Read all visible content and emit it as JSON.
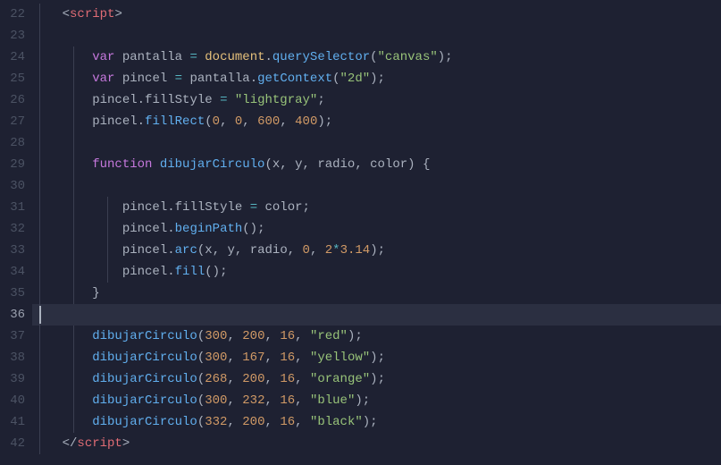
{
  "lineStart": 22,
  "activeLine": 36,
  "cursorLeft": 8,
  "indent": "    ",
  "lines": [
    {
      "pad": 1,
      "guides": [
        1
      ],
      "tokens": [
        {
          "c": "punc",
          "t": "<"
        },
        {
          "c": "tag",
          "t": "script"
        },
        {
          "c": "punc",
          "t": ">"
        }
      ]
    },
    {
      "pad": 1,
      "guides": [
        1
      ],
      "tokens": []
    },
    {
      "pad": 2,
      "guides": [
        1,
        2
      ],
      "tokens": [
        {
          "c": "kw",
          "t": "var"
        },
        {
          "c": "plain",
          "t": " "
        },
        {
          "c": "plain",
          "t": "pantalla"
        },
        {
          "c": "plain",
          "t": " "
        },
        {
          "c": "op",
          "t": "="
        },
        {
          "c": "plain",
          "t": " "
        },
        {
          "c": "var",
          "t": "document"
        },
        {
          "c": "punc",
          "t": "."
        },
        {
          "c": "fn",
          "t": "querySelector"
        },
        {
          "c": "punc",
          "t": "("
        },
        {
          "c": "str",
          "t": "\"canvas\""
        },
        {
          "c": "punc",
          "t": ")"
        },
        {
          "c": "punc",
          "t": ";"
        }
      ]
    },
    {
      "pad": 2,
      "guides": [
        1,
        2
      ],
      "tokens": [
        {
          "c": "kw",
          "t": "var"
        },
        {
          "c": "plain",
          "t": " "
        },
        {
          "c": "plain",
          "t": "pincel"
        },
        {
          "c": "plain",
          "t": " "
        },
        {
          "c": "op",
          "t": "="
        },
        {
          "c": "plain",
          "t": " "
        },
        {
          "c": "plain",
          "t": "pantalla"
        },
        {
          "c": "punc",
          "t": "."
        },
        {
          "c": "fn",
          "t": "getContext"
        },
        {
          "c": "punc",
          "t": "("
        },
        {
          "c": "str",
          "t": "\"2d\""
        },
        {
          "c": "punc",
          "t": ")"
        },
        {
          "c": "punc",
          "t": ";"
        }
      ]
    },
    {
      "pad": 2,
      "guides": [
        1,
        2
      ],
      "tokens": [
        {
          "c": "plain",
          "t": "pincel"
        },
        {
          "c": "punc",
          "t": "."
        },
        {
          "c": "plain",
          "t": "fillStyle"
        },
        {
          "c": "plain",
          "t": " "
        },
        {
          "c": "op",
          "t": "="
        },
        {
          "c": "plain",
          "t": " "
        },
        {
          "c": "str",
          "t": "\"lightgray\""
        },
        {
          "c": "punc",
          "t": ";"
        }
      ]
    },
    {
      "pad": 2,
      "guides": [
        1,
        2
      ],
      "tokens": [
        {
          "c": "plain",
          "t": "pincel"
        },
        {
          "c": "punc",
          "t": "."
        },
        {
          "c": "fn",
          "t": "fillRect"
        },
        {
          "c": "punc",
          "t": "("
        },
        {
          "c": "num",
          "t": "0"
        },
        {
          "c": "punc",
          "t": ", "
        },
        {
          "c": "num",
          "t": "0"
        },
        {
          "c": "punc",
          "t": ", "
        },
        {
          "c": "num",
          "t": "600"
        },
        {
          "c": "punc",
          "t": ", "
        },
        {
          "c": "num",
          "t": "400"
        },
        {
          "c": "punc",
          "t": ")"
        },
        {
          "c": "punc",
          "t": ";"
        }
      ]
    },
    {
      "pad": 2,
      "guides": [
        1,
        2
      ],
      "tokens": []
    },
    {
      "pad": 2,
      "guides": [
        1,
        2
      ],
      "tokens": [
        {
          "c": "kw",
          "t": "function"
        },
        {
          "c": "plain",
          "t": " "
        },
        {
          "c": "fn",
          "t": "dibujarCirculo"
        },
        {
          "c": "punc",
          "t": "("
        },
        {
          "c": "param",
          "t": "x"
        },
        {
          "c": "punc",
          "t": ", "
        },
        {
          "c": "param",
          "t": "y"
        },
        {
          "c": "punc",
          "t": ", "
        },
        {
          "c": "param",
          "t": "radio"
        },
        {
          "c": "punc",
          "t": ", "
        },
        {
          "c": "param",
          "t": "color"
        },
        {
          "c": "punc",
          "t": ")"
        },
        {
          "c": "plain",
          "t": " "
        },
        {
          "c": "punc",
          "t": "{"
        }
      ]
    },
    {
      "pad": 2,
      "guides": [
        1,
        2
      ],
      "tokens": []
    },
    {
      "pad": 3,
      "guides": [
        1,
        2,
        3
      ],
      "tokens": [
        {
          "c": "plain",
          "t": "pincel"
        },
        {
          "c": "punc",
          "t": "."
        },
        {
          "c": "plain",
          "t": "fillStyle"
        },
        {
          "c": "plain",
          "t": " "
        },
        {
          "c": "op",
          "t": "="
        },
        {
          "c": "plain",
          "t": " "
        },
        {
          "c": "plain",
          "t": "color"
        },
        {
          "c": "punc",
          "t": ";"
        }
      ]
    },
    {
      "pad": 3,
      "guides": [
        1,
        2,
        3
      ],
      "tokens": [
        {
          "c": "plain",
          "t": "pincel"
        },
        {
          "c": "punc",
          "t": "."
        },
        {
          "c": "fn",
          "t": "beginPath"
        },
        {
          "c": "punc",
          "t": "()"
        },
        {
          "c": "punc",
          "t": ";"
        }
      ]
    },
    {
      "pad": 3,
      "guides": [
        1,
        2,
        3
      ],
      "tokens": [
        {
          "c": "plain",
          "t": "pincel"
        },
        {
          "c": "punc",
          "t": "."
        },
        {
          "c": "fn",
          "t": "arc"
        },
        {
          "c": "punc",
          "t": "("
        },
        {
          "c": "plain",
          "t": "x"
        },
        {
          "c": "punc",
          "t": ", "
        },
        {
          "c": "plain",
          "t": "y"
        },
        {
          "c": "punc",
          "t": ", "
        },
        {
          "c": "plain",
          "t": "radio"
        },
        {
          "c": "punc",
          "t": ", "
        },
        {
          "c": "num",
          "t": "0"
        },
        {
          "c": "punc",
          "t": ", "
        },
        {
          "c": "num",
          "t": "2"
        },
        {
          "c": "op",
          "t": "*"
        },
        {
          "c": "num",
          "t": "3.14"
        },
        {
          "c": "punc",
          "t": ")"
        },
        {
          "c": "punc",
          "t": ";"
        }
      ]
    },
    {
      "pad": 3,
      "guides": [
        1,
        2,
        3
      ],
      "tokens": [
        {
          "c": "plain",
          "t": "pincel"
        },
        {
          "c": "punc",
          "t": "."
        },
        {
          "c": "fn",
          "t": "fill"
        },
        {
          "c": "punc",
          "t": "()"
        },
        {
          "c": "punc",
          "t": ";"
        }
      ]
    },
    {
      "pad": 2,
      "guides": [
        1,
        2
      ],
      "tokens": [
        {
          "c": "punc",
          "t": "}"
        }
      ]
    },
    {
      "pad": 1,
      "guides": [
        1
      ],
      "highlight": true,
      "cursor": true,
      "tokens": []
    },
    {
      "pad": 2,
      "guides": [
        1,
        2
      ],
      "tokens": [
        {
          "c": "fn",
          "t": "dibujarCirculo"
        },
        {
          "c": "punc",
          "t": "("
        },
        {
          "c": "num",
          "t": "300"
        },
        {
          "c": "punc",
          "t": ", "
        },
        {
          "c": "num",
          "t": "200"
        },
        {
          "c": "punc",
          "t": ", "
        },
        {
          "c": "num",
          "t": "16"
        },
        {
          "c": "punc",
          "t": ", "
        },
        {
          "c": "str",
          "t": "\"red\""
        },
        {
          "c": "punc",
          "t": ")"
        },
        {
          "c": "punc",
          "t": ";"
        }
      ]
    },
    {
      "pad": 2,
      "guides": [
        1,
        2
      ],
      "tokens": [
        {
          "c": "fn",
          "t": "dibujarCirculo"
        },
        {
          "c": "punc",
          "t": "("
        },
        {
          "c": "num",
          "t": "300"
        },
        {
          "c": "punc",
          "t": ", "
        },
        {
          "c": "num",
          "t": "167"
        },
        {
          "c": "punc",
          "t": ", "
        },
        {
          "c": "num",
          "t": "16"
        },
        {
          "c": "punc",
          "t": ", "
        },
        {
          "c": "str",
          "t": "\"yellow\""
        },
        {
          "c": "punc",
          "t": ")"
        },
        {
          "c": "punc",
          "t": ";"
        }
      ]
    },
    {
      "pad": 2,
      "guides": [
        1,
        2
      ],
      "tokens": [
        {
          "c": "fn",
          "t": "dibujarCirculo"
        },
        {
          "c": "punc",
          "t": "("
        },
        {
          "c": "num",
          "t": "268"
        },
        {
          "c": "punc",
          "t": ", "
        },
        {
          "c": "num",
          "t": "200"
        },
        {
          "c": "punc",
          "t": ", "
        },
        {
          "c": "num",
          "t": "16"
        },
        {
          "c": "punc",
          "t": ", "
        },
        {
          "c": "str",
          "t": "\"orange\""
        },
        {
          "c": "punc",
          "t": ")"
        },
        {
          "c": "punc",
          "t": ";"
        }
      ]
    },
    {
      "pad": 2,
      "guides": [
        1,
        2
      ],
      "tokens": [
        {
          "c": "fn",
          "t": "dibujarCirculo"
        },
        {
          "c": "punc",
          "t": "("
        },
        {
          "c": "num",
          "t": "300"
        },
        {
          "c": "punc",
          "t": ", "
        },
        {
          "c": "num",
          "t": "232"
        },
        {
          "c": "punc",
          "t": ", "
        },
        {
          "c": "num",
          "t": "16"
        },
        {
          "c": "punc",
          "t": ", "
        },
        {
          "c": "str",
          "t": "\"blue\""
        },
        {
          "c": "punc",
          "t": ")"
        },
        {
          "c": "punc",
          "t": ";"
        }
      ]
    },
    {
      "pad": 2,
      "guides": [
        1,
        2
      ],
      "tokens": [
        {
          "c": "fn",
          "t": "dibujarCirculo"
        },
        {
          "c": "punc",
          "t": "("
        },
        {
          "c": "num",
          "t": "332"
        },
        {
          "c": "punc",
          "t": ", "
        },
        {
          "c": "num",
          "t": "200"
        },
        {
          "c": "punc",
          "t": ", "
        },
        {
          "c": "num",
          "t": "16"
        },
        {
          "c": "punc",
          "t": ", "
        },
        {
          "c": "str",
          "t": "\"black\""
        },
        {
          "c": "punc",
          "t": ")"
        },
        {
          "c": "punc",
          "t": ";"
        }
      ]
    },
    {
      "pad": 1,
      "guides": [
        1
      ],
      "tokens": [
        {
          "c": "punc",
          "t": "</"
        },
        {
          "c": "tag",
          "t": "script"
        },
        {
          "c": "punc",
          "t": ">"
        }
      ]
    }
  ]
}
